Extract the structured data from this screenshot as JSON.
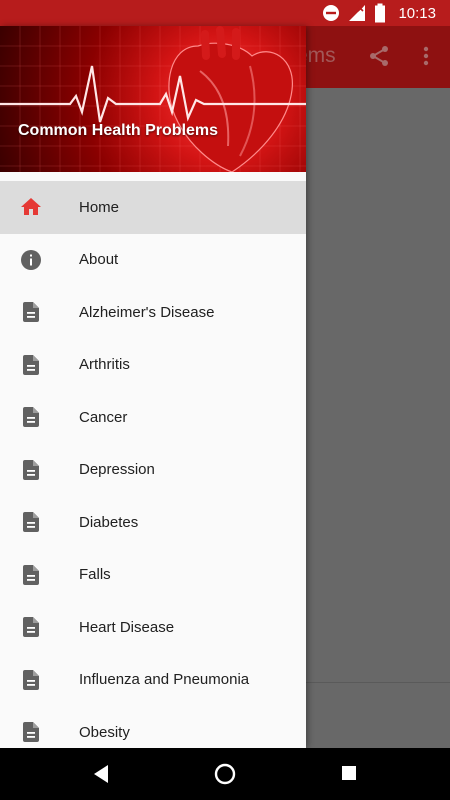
{
  "status_bar": {
    "time": "10:13",
    "icons": [
      "do-not-disturb-icon",
      "signal-no-data-icon",
      "battery-icon"
    ]
  },
  "app_bar": {
    "title_partial": "ems",
    "actions": [
      "share-icon",
      "more-vert-icon"
    ]
  },
  "drawer": {
    "header_title": "Common Health Problems",
    "items": [
      {
        "label": "Home",
        "icon": "home-icon",
        "active": true
      },
      {
        "label": "About",
        "icon": "info-icon",
        "active": false
      },
      {
        "label": "Alzheimer's Disease",
        "icon": "document-icon",
        "active": false
      },
      {
        "label": "Arthritis",
        "icon": "document-icon",
        "active": false
      },
      {
        "label": "Cancer",
        "icon": "document-icon",
        "active": false
      },
      {
        "label": "Depression",
        "icon": "document-icon",
        "active": false
      },
      {
        "label": "Diabetes",
        "icon": "document-icon",
        "active": false
      },
      {
        "label": "Falls",
        "icon": "document-icon",
        "active": false
      },
      {
        "label": "Heart Disease",
        "icon": "document-icon",
        "active": false
      },
      {
        "label": "Influenza and Pneumonia",
        "icon": "document-icon",
        "active": false
      },
      {
        "label": "Obesity",
        "icon": "document-icon",
        "active": false
      }
    ]
  },
  "nav_bar": {
    "buttons": [
      "back-icon",
      "home-circle-icon",
      "recents-icon"
    ]
  },
  "colors": {
    "status_bar": "#b71c1c",
    "app_bar": "#8e1111",
    "accent": "#e53935",
    "icon_gray": "#616161",
    "active_bg": "#dcdcdc"
  }
}
